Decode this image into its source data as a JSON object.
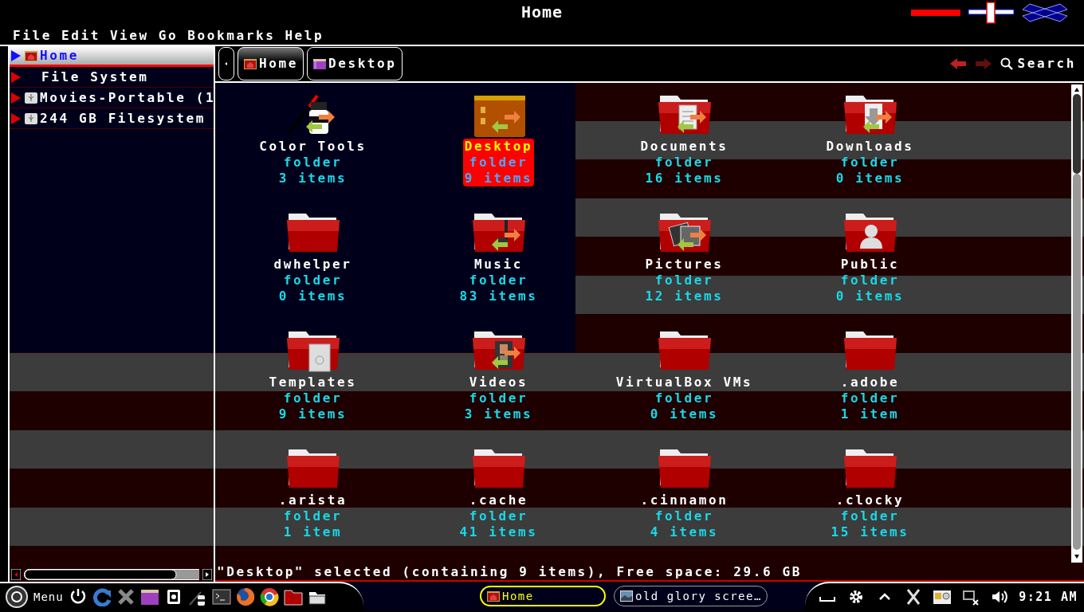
{
  "window": {
    "title": "Home"
  },
  "menu": [
    "File",
    "Edit",
    "View",
    "Go",
    "Bookmarks",
    "Help"
  ],
  "sidebar": {
    "items": [
      {
        "label": "Home",
        "selected": true,
        "kind": "home"
      },
      {
        "label": "File System",
        "selected": false,
        "kind": "root"
      },
      {
        "label": "Movies-Portable (1",
        "selected": false,
        "kind": "drive"
      },
      {
        "label": "244 GB Filesystem",
        "selected": false,
        "kind": "drive"
      }
    ]
  },
  "breadcrumbs": [
    {
      "label": "Home",
      "selected": true,
      "kind": "home"
    },
    {
      "label": "Desktop",
      "selected": false,
      "kind": "desktop"
    }
  ],
  "search": {
    "label": "Search"
  },
  "files": [
    {
      "name": "Color Tools",
      "type": "folder",
      "count": "3 items",
      "kind": "tools",
      "linked": true,
      "selected": false
    },
    {
      "name": "Desktop",
      "type": "folder",
      "count": "9 items",
      "kind": "desktop",
      "linked": true,
      "selected": true
    },
    {
      "name": "Documents",
      "type": "folder",
      "count": "16 items",
      "kind": "documents",
      "linked": true,
      "selected": false
    },
    {
      "name": "Downloads",
      "type": "folder",
      "count": "0 items",
      "kind": "downloads",
      "linked": true,
      "selected": false
    },
    {
      "name": "dwhelper",
      "type": "folder",
      "count": "0 items",
      "kind": "plain",
      "linked": false,
      "selected": false
    },
    {
      "name": "Music",
      "type": "folder",
      "count": "83 items",
      "kind": "music",
      "linked": true,
      "selected": false
    },
    {
      "name": "Pictures",
      "type": "folder",
      "count": "12 items",
      "kind": "pictures",
      "linked": true,
      "selected": false
    },
    {
      "name": "Public",
      "type": "folder",
      "count": "0 items",
      "kind": "public",
      "linked": false,
      "selected": false
    },
    {
      "name": "Templates",
      "type": "folder",
      "count": "9 items",
      "kind": "templates",
      "linked": false,
      "selected": false
    },
    {
      "name": "Videos",
      "type": "folder",
      "count": "3 items",
      "kind": "videos",
      "linked": true,
      "selected": false
    },
    {
      "name": "VirtualBox VMs",
      "type": "folder",
      "count": "0 items",
      "kind": "plain",
      "linked": false,
      "selected": false
    },
    {
      "name": ".adobe",
      "type": "folder",
      "count": "1 item",
      "kind": "plain",
      "linked": false,
      "selected": false
    },
    {
      "name": ".arista",
      "type": "folder",
      "count": "1 item",
      "kind": "plain",
      "linked": false,
      "selected": false
    },
    {
      "name": ".cache",
      "type": "folder",
      "count": "41 items",
      "kind": "plain",
      "linked": false,
      "selected": false
    },
    {
      "name": ".cinnamon",
      "type": "folder",
      "count": "4 items",
      "kind": "plain",
      "linked": false,
      "selected": false
    },
    {
      "name": ".clocky",
      "type": "folder",
      "count": "15 items",
      "kind": "plain",
      "linked": false,
      "selected": false
    }
  ],
  "status_bar": "\"Desktop\" selected (containing 9 items), Free space: 29.6 GB",
  "taskbar": {
    "menu_label": "Menu",
    "windows": [
      {
        "label": "Home",
        "selected": true,
        "kind": "home"
      },
      {
        "label": "old glory scree…",
        "selected": false,
        "kind": "image"
      }
    ],
    "clock": "9:21 AM"
  }
}
